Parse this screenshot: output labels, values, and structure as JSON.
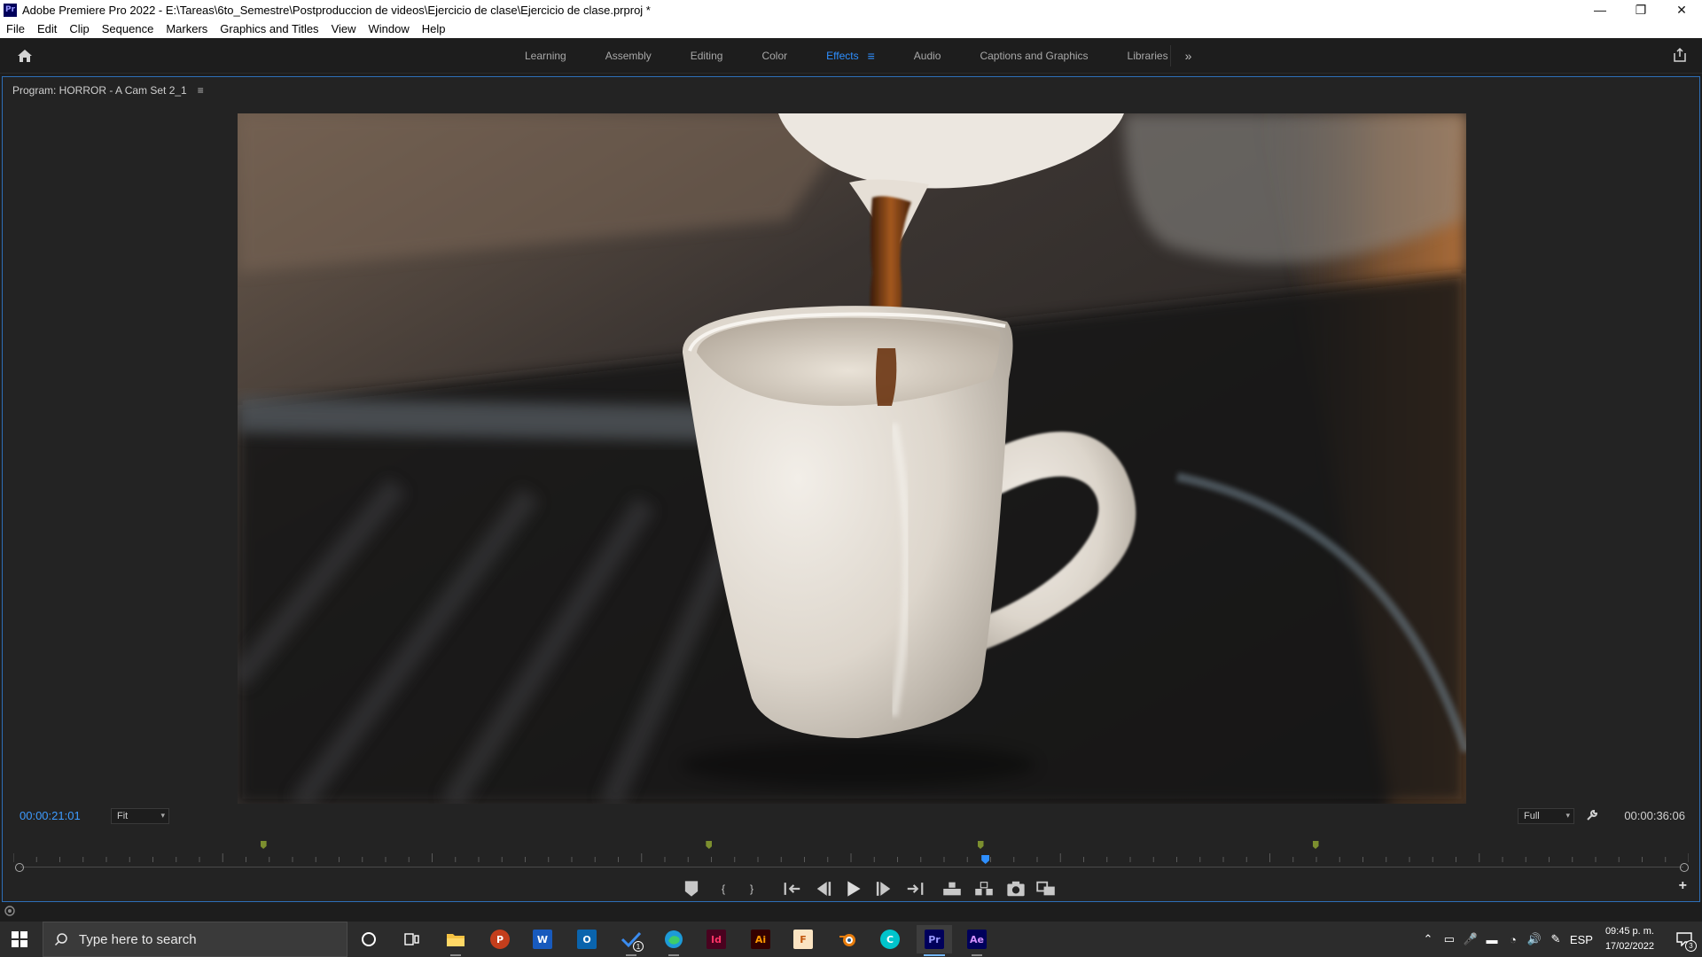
{
  "window": {
    "app_badge": "Pr",
    "title": "Adobe Premiere Pro 2022 - E:\\Tareas\\6to_Semestre\\Postproduccion de videos\\Ejercicio de clase\\Ejercicio de clase.prproj *",
    "controls": {
      "minimize": "—",
      "maximize": "❐",
      "close": "✕"
    }
  },
  "menu": [
    "File",
    "Edit",
    "Clip",
    "Sequence",
    "Markers",
    "Graphics and Titles",
    "View",
    "Window",
    "Help"
  ],
  "workspaces": {
    "tabs": [
      {
        "label": "Learning",
        "active": false
      },
      {
        "label": "Assembly",
        "active": false
      },
      {
        "label": "Editing",
        "active": false
      },
      {
        "label": "Color",
        "active": false
      },
      {
        "label": "Effects",
        "active": true
      },
      {
        "label": "Audio",
        "active": false
      },
      {
        "label": "Captions and Graphics",
        "active": false
      },
      {
        "label": "Libraries",
        "active": false
      }
    ],
    "overflow_glyph": "»",
    "active_menu_glyph": "≡",
    "accent_color": "#2e8fff"
  },
  "program_monitor": {
    "title": "Program: HORROR - A Cam Set 2_1",
    "menu_glyph": "≡",
    "current_timecode": "00:00:21:01",
    "duration_timecode": "00:00:36:06",
    "zoom": "Fit",
    "resolution": "Full",
    "playhead_position_fraction": 0.58,
    "marker_positions_fraction": [
      0.149,
      0.415,
      0.577,
      0.777
    ]
  },
  "transport_icons": [
    "add-marker-icon",
    "mark-in-icon",
    "mark-out-icon",
    "go-to-in-icon",
    "step-back-icon",
    "play-icon",
    "step-forward-icon",
    "go-to-out-icon",
    "lift-icon",
    "extract-icon",
    "export-frame-icon",
    "comparison-view-icon"
  ],
  "taskbar": {
    "search_placeholder": "Type here to search",
    "apps": [
      {
        "name": "cortana",
        "label": ""
      },
      {
        "name": "task-view",
        "label": ""
      },
      {
        "name": "file-explorer",
        "label": ""
      },
      {
        "name": "powerpoint",
        "label": "P"
      },
      {
        "name": "word",
        "label": "W"
      },
      {
        "name": "outlook",
        "label": "O"
      },
      {
        "name": "todo",
        "label": "1"
      },
      {
        "name": "edge",
        "label": ""
      },
      {
        "name": "indesign",
        "label": "Id"
      },
      {
        "name": "illustrator",
        "label": "Ai"
      },
      {
        "name": "fresco",
        "label": "F"
      },
      {
        "name": "blender",
        "label": ""
      },
      {
        "name": "canva",
        "label": "C"
      },
      {
        "name": "premiere-pro",
        "label": "Pr"
      },
      {
        "name": "after-effects",
        "label": "Ae"
      }
    ],
    "language": "ESP",
    "time": "09:45 p. m.",
    "date": "17/02/2022",
    "notification_count": "3"
  }
}
